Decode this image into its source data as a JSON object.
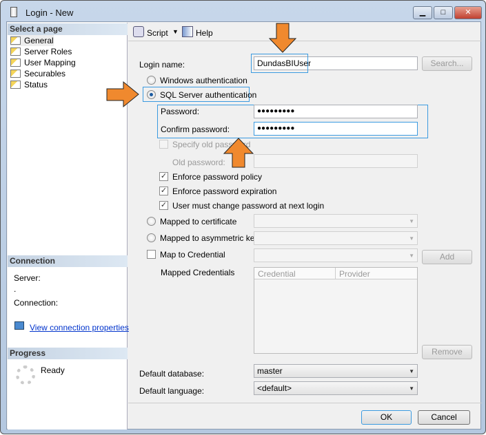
{
  "window": {
    "title": "Login - New",
    "min": "▁",
    "max": "□",
    "close": "✕"
  },
  "left": {
    "select_header": "Select a page",
    "pages": [
      "General",
      "Server Roles",
      "User Mapping",
      "Securables",
      "Status"
    ],
    "connection_header": "Connection",
    "server_label": "Server:",
    "server_value": ".",
    "connection_label": "Connection:",
    "view_link": "View connection properties",
    "progress_header": "Progress",
    "progress_status": "Ready"
  },
  "toolbar": {
    "script": "Script",
    "help": "Help"
  },
  "form": {
    "login_name_label": "Login name:",
    "login_name_value": "DundasBIUser",
    "search": "Search...",
    "windows_auth": "Windows authentication",
    "sql_auth": "SQL Server authentication",
    "password_label": "Password:",
    "password_value": "●●●●●●●●●",
    "confirm_label": "Confirm password:",
    "confirm_value": "●●●●●●●●●",
    "specify_old": "Specify old password",
    "old_password_label": "Old password:",
    "enforce_policy": "Enforce password policy",
    "enforce_expiration": "Enforce password expiration",
    "must_change": "User must change password at next login",
    "mapped_cert": "Mapped to certificate",
    "mapped_key": "Mapped to asymmetric key",
    "map_credential": "Map to Credential",
    "add": "Add",
    "mapped_credentials": "Mapped Credentials",
    "cred_cols": [
      "Credential",
      "Provider"
    ],
    "remove": "Remove",
    "default_db_label": "Default database:",
    "default_db": "master",
    "default_lang_label": "Default language:",
    "default_lang": "<default>"
  },
  "footer": {
    "ok": "OK",
    "cancel": "Cancel"
  },
  "colors": {
    "arrow": "#f0892e",
    "highlight": "#3a9ae0"
  }
}
